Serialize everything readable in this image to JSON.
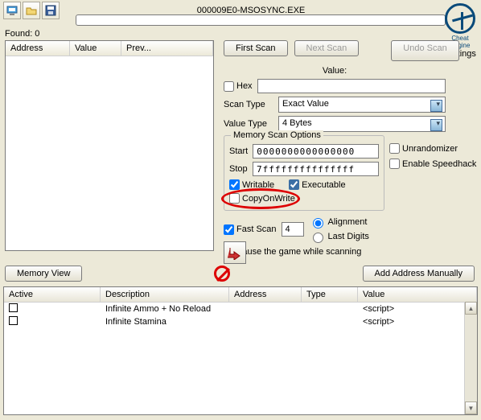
{
  "header": {
    "title": "000009E0-MSOSYNC.EXE"
  },
  "logo": {
    "brand": "Cheat Engine",
    "settings": "Settings"
  },
  "found": {
    "label": "Found: 0"
  },
  "addrTable": {
    "col_address": "Address",
    "col_value": "Value",
    "col_prev": "Prev..."
  },
  "buttons": {
    "first_scan": "First Scan",
    "next_scan": "Next Scan",
    "undo_scan": "Undo Scan",
    "memory_view": "Memory View",
    "add_manual": "Add Address Manually"
  },
  "scan": {
    "value_label": "Value:",
    "hex": "Hex",
    "scan_type_label": "Scan Type",
    "scan_type_value": "Exact Value",
    "value_type_label": "Value Type",
    "value_type_value": "4 Bytes",
    "mem_opts_title": "Memory Scan Options",
    "start_label": "Start",
    "start_value": "0000000000000000",
    "stop_label": "Stop",
    "stop_value": "7fffffffffffffff",
    "writable": "Writable",
    "executable": "Executable",
    "copyonwrite": "CopyOnWrite",
    "fastscan": "Fast Scan",
    "fastscan_value": "4",
    "alignment": "Alignment",
    "lastdigits": "Last Digits",
    "pause": "Pause the game while scanning"
  },
  "side": {
    "unrandomizer": "Unrandomizer",
    "speedhack": "Enable Speedhack"
  },
  "cheatTable": {
    "cols": {
      "active": "Active",
      "description": "Description",
      "address": "Address",
      "type": "Type",
      "value": "Value"
    },
    "rows": [
      {
        "desc": "Infinite Ammo + No Reload",
        "addr": "",
        "type": "",
        "value": "<script>"
      },
      {
        "desc": "Infinite Stamina",
        "addr": "",
        "type": "",
        "value": "<script>"
      }
    ]
  }
}
